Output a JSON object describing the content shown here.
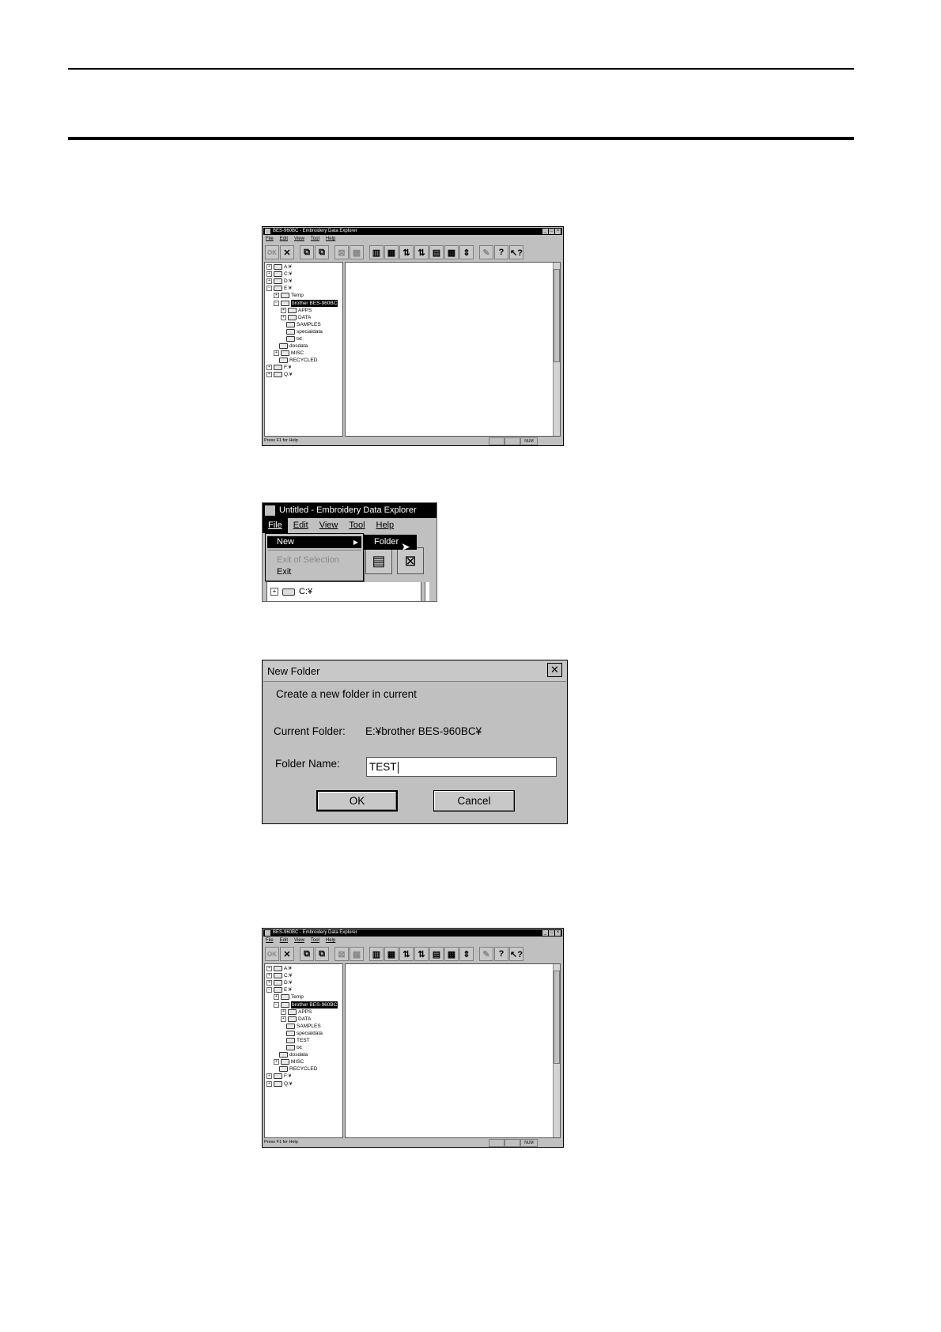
{
  "explorer_before": {
    "title": "BES-960BC - Embroidery Data Explorer",
    "minimize": "_",
    "maximize": "□",
    "close": "×",
    "menu": [
      "File",
      "Edit",
      "View",
      "Tool",
      "Help"
    ],
    "toolbar": [
      "OK",
      "✕",
      "⧉",
      "⧉",
      "⊠",
      "▦",
      "▥",
      "▦",
      "⇅",
      "⇅",
      "▤",
      "▦",
      "⇕",
      "✎",
      "?",
      "↖?"
    ],
    "tree": [
      {
        "indent": 0,
        "exp": "+",
        "label": "A:¥"
      },
      {
        "indent": 0,
        "exp": "+",
        "label": "C:¥"
      },
      {
        "indent": 0,
        "exp": "+",
        "label": "D:¥"
      },
      {
        "indent": 0,
        "exp": "−",
        "label": "E:¥"
      },
      {
        "indent": 1,
        "exp": "+",
        "label": "Temp"
      },
      {
        "indent": 1,
        "exp": "−",
        "label": "brother BES-960BC",
        "selected": true
      },
      {
        "indent": 2,
        "exp": "+",
        "label": "APPS"
      },
      {
        "indent": 2,
        "exp": "+",
        "label": "DATA"
      },
      {
        "indent": 2,
        "exp": "",
        "label": "SAMPLES"
      },
      {
        "indent": 2,
        "exp": "",
        "label": "specialdata"
      },
      {
        "indent": 2,
        "exp": "",
        "label": "txt"
      },
      {
        "indent": 1,
        "exp": "",
        "label": "dosdata"
      },
      {
        "indent": 1,
        "exp": "+",
        "label": "MISC"
      },
      {
        "indent": 1,
        "exp": "",
        "label": "RECYCLED"
      },
      {
        "indent": 0,
        "exp": "+",
        "label": "F:¥"
      },
      {
        "indent": 0,
        "exp": "+",
        "label": "Q:¥"
      }
    ],
    "status": "Press F1 for Help",
    "status_num": "NUM"
  },
  "menu_crop": {
    "title": "Untitled - Embroidery Data Explorer",
    "menu": [
      "File",
      "Edit",
      "View",
      "Tool",
      "Help"
    ],
    "new_item": "New",
    "submenu_arrow": "▶",
    "submenu_item": "Folder",
    "exit_selection": "Exit of Selection",
    "exit": "Exit",
    "tree_exp": "+",
    "tree_label": "C:¥",
    "bg_buttons": [
      "▤",
      "⊠"
    ],
    "cursor": "➤"
  },
  "dialog": {
    "title": "New Folder",
    "close": "✕",
    "message": "Create a new folder in current",
    "current_folder_label": "Current Folder:",
    "current_folder_value": "E:¥brother BES-960BC¥",
    "folder_name_label": "Folder Name:",
    "folder_name_value": "TEST",
    "ok": "OK",
    "cancel": "Cancel"
  },
  "explorer_after": {
    "title": "BES-960BC - Embroidery Data Explorer",
    "minimize": "_",
    "maximize": "□",
    "close": "×",
    "menu": [
      "File",
      "Edit",
      "View",
      "Tool",
      "Help"
    ],
    "toolbar": [
      "OK",
      "✕",
      "⧉",
      "⧉",
      "⊠",
      "▦",
      "▥",
      "▦",
      "⇅",
      "⇅",
      "▤",
      "▦",
      "⇕",
      "✎",
      "?",
      "↖?"
    ],
    "tree": [
      {
        "indent": 0,
        "exp": "+",
        "label": "A:¥"
      },
      {
        "indent": 0,
        "exp": "+",
        "label": "C:¥"
      },
      {
        "indent": 0,
        "exp": "+",
        "label": "D:¥"
      },
      {
        "indent": 0,
        "exp": "−",
        "label": "E:¥"
      },
      {
        "indent": 1,
        "exp": "+",
        "label": "Temp"
      },
      {
        "indent": 1,
        "exp": "−",
        "label": "brother BES-960BC",
        "selected": true
      },
      {
        "indent": 2,
        "exp": "+",
        "label": "APPS"
      },
      {
        "indent": 2,
        "exp": "+",
        "label": "DATA"
      },
      {
        "indent": 2,
        "exp": "",
        "label": "SAMPLES"
      },
      {
        "indent": 2,
        "exp": "",
        "label": "specialdata"
      },
      {
        "indent": 2,
        "exp": "",
        "label": "TEST"
      },
      {
        "indent": 2,
        "exp": "",
        "label": "txt"
      },
      {
        "indent": 1,
        "exp": "",
        "label": "dosdata"
      },
      {
        "indent": 1,
        "exp": "+",
        "label": "MISC"
      },
      {
        "indent": 1,
        "exp": "",
        "label": "RECYCLED"
      },
      {
        "indent": 0,
        "exp": "+",
        "label": "F:¥"
      },
      {
        "indent": 0,
        "exp": "+",
        "label": "Q:¥"
      }
    ],
    "status": "Press F1 for Help",
    "status_num": "NUM"
  }
}
